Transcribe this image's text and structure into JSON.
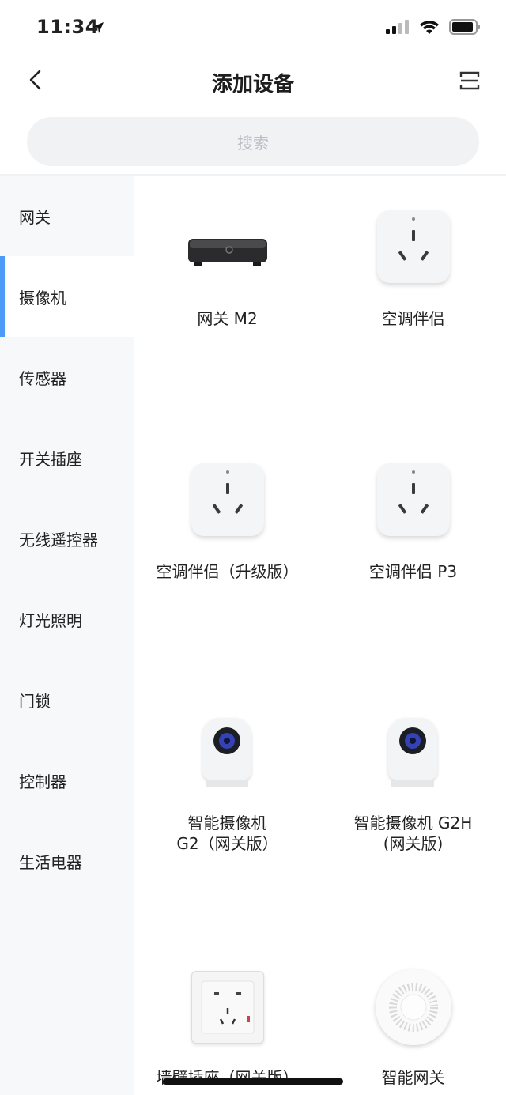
{
  "status_bar": {
    "time": "11:34"
  },
  "header": {
    "title": "添加设备"
  },
  "search": {
    "placeholder": "搜索"
  },
  "sidebar": {
    "items": [
      {
        "label": "网关"
      },
      {
        "label": "摄像机"
      },
      {
        "label": "传感器"
      },
      {
        "label": "开关插座"
      },
      {
        "label": "无线遥控器"
      },
      {
        "label": "灯光照明"
      },
      {
        "label": "门锁"
      },
      {
        "label": "控制器"
      },
      {
        "label": "生活电器"
      }
    ],
    "active_index": 1,
    "accent_color": "#4b9bf7"
  },
  "devices": [
    {
      "label": "网关 M2",
      "icon": "gateway-m2-icon"
    },
    {
      "label": "空调伴侣",
      "icon": "ac-companion-icon"
    },
    {
      "label": "空调伴侣（升级版）",
      "icon": "ac-companion-icon"
    },
    {
      "label": "空调伴侣 P3",
      "icon": "ac-companion-icon"
    },
    {
      "label_line1": "智能摄像机",
      "label_line2": "G2（网关版）",
      "icon": "camera-icon"
    },
    {
      "label_line1": "智能摄像机 G2H",
      "label_line2": "(网关版)",
      "icon": "camera-icon"
    },
    {
      "label": "墙壁插座（网关版）",
      "icon": "wall-socket-icon"
    },
    {
      "label": "智能网关",
      "icon": "smart-gateway-icon"
    }
  ]
}
